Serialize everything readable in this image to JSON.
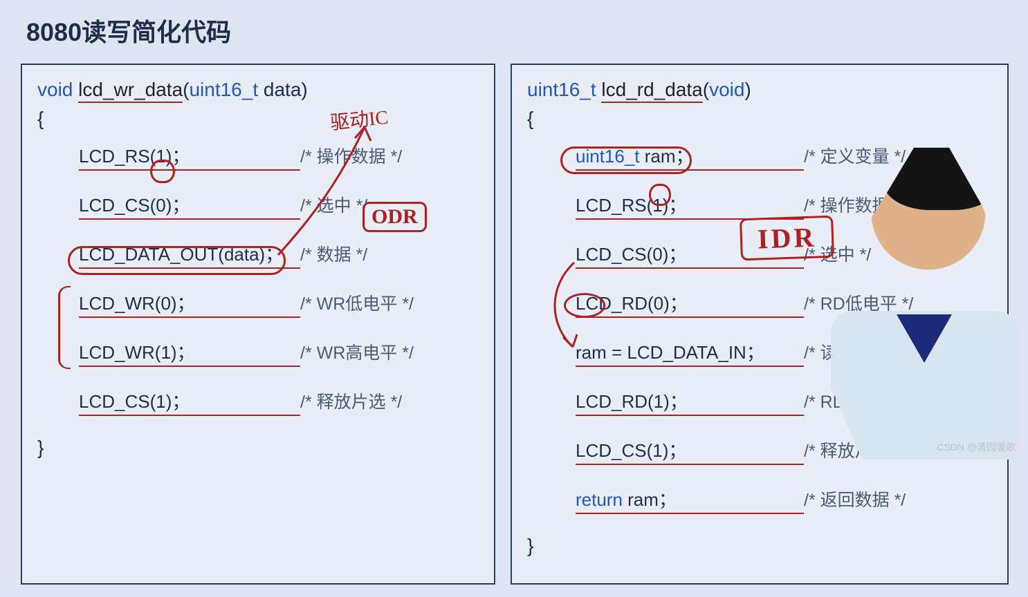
{
  "title": "8080读写简化代码",
  "left": {
    "retType": "void",
    "funcName": "lcd_wr_data",
    "paramType": "uint16_t",
    "paramName": "data",
    "lines": [
      {
        "stmt": "LCD_RS(1)；",
        "cmt": "/* 操作数据 */"
      },
      {
        "stmt": "LCD_CS(0)；",
        "cmt": "/* 选中 */"
      },
      {
        "stmt": "LCD_DATA_OUT(data)；",
        "cmt": "/* 数据 */"
      },
      {
        "stmt": "LCD_WR(0)；",
        "cmt": "/* WR低电平 */"
      },
      {
        "stmt": "LCD_WR(1)；",
        "cmt": "/* WR高电平 */"
      },
      {
        "stmt": "LCD_CS(1)；",
        "cmt": "/* 释放片选 */"
      }
    ],
    "annotations": {
      "odr": "ODR",
      "driverIC": "驱动IC"
    }
  },
  "right": {
    "retType": "uint16_t",
    "funcName": "lcd_rd_data",
    "paramType": "void",
    "lines": [
      {
        "stmt_type": "uint16_t",
        "stmt_rest": " ram；",
        "cmt": "/* 定义变量 */"
      },
      {
        "stmt": "LCD_RS(1)；",
        "cmt": "/* 操作数据 */"
      },
      {
        "stmt": "LCD_CS(0)；",
        "cmt": "/* 选中 */"
      },
      {
        "stmt": "LCD_RD(0)；",
        "cmt": "/* RD低电平 */"
      },
      {
        "stmt": "ram = LCD_DATA_IN；",
        "cmt": "/* 读取数据 */"
      },
      {
        "stmt": "LCD_RD(1)；",
        "cmt": "/* RD高电平 */"
      },
      {
        "stmt": "LCD_CS(1)；",
        "cmt": "/* 释放片选 */"
      },
      {
        "stmt_kw": "return",
        "stmt_rest": " ram；",
        "cmt": "/* 返回数据 */"
      }
    ],
    "annotations": {
      "idr": "IDR"
    }
  },
  "watermark": "CSDN @清园暖歌"
}
